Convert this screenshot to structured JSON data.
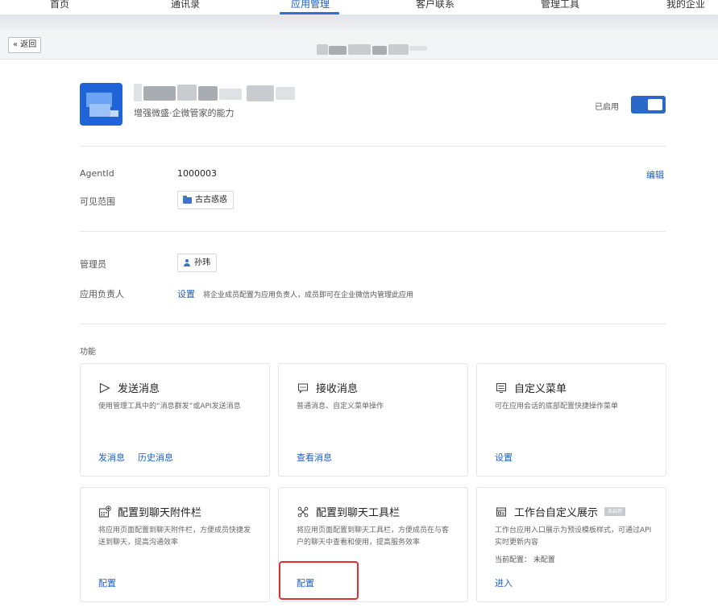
{
  "nav": {
    "items": [
      "首页",
      "通讯录",
      "应用管理",
      "客户联系",
      "管理工具",
      "我的企业"
    ],
    "active_index": 2
  },
  "subheader": {
    "back_label": "« 返回"
  },
  "app": {
    "subtitle": "增强微盛·企微管家的能力",
    "status_label": "已启用",
    "enabled": true
  },
  "info": {
    "agentid_label": "AgentId",
    "agentid_value": "1000003",
    "edit_label": "编辑",
    "visible_label": "可见范围",
    "visible_value": "古古惑惑",
    "admin_label": "管理员",
    "admin_value": "孙玮",
    "owner_label": "应用负责人",
    "owner_action": "设置",
    "owner_hint": "将企业成员配置为应用负责人，成员即可在企业微信内管理此应用"
  },
  "functions": {
    "section_label": "功能",
    "cards": [
      {
        "title": "发送消息",
        "icon": "send-icon",
        "desc": "使用管理工具中的“消息群发”或API发送消息",
        "actions": [
          "发消息",
          "历史消息"
        ]
      },
      {
        "title": "接收消息",
        "icon": "chat-bubble-icon",
        "desc": "普通消息、自定义菜单操作",
        "actions": [
          "查看消息"
        ]
      },
      {
        "title": "自定义菜单",
        "icon": "menu-icon",
        "desc": "可在应用会话的底部配置快捷操作菜单",
        "actions": [
          "设置"
        ]
      },
      {
        "title": "配置到聊天附件栏",
        "icon": "attachment-grid-icon",
        "desc": "将应用页面配置到聊天附件栏，方便成员快捷发送到聊天，提高沟通效率",
        "actions": [
          "配置"
        ]
      },
      {
        "title": "配置到聊天工具栏",
        "icon": "toolbar-icon",
        "desc": "将应用页面配置到聊天工具栏，方便成员在与客户的聊天中查看和使用，提高服务效率",
        "actions": [
          "配置"
        ]
      },
      {
        "title": "工作台自定义展示",
        "icon": "workbench-icon",
        "badge": "未启用",
        "desc": "工作台应用入口展示为预设模板样式，可通过API实时更新内容",
        "extra": "当前配置：  未配置",
        "actions": [
          "进入"
        ]
      }
    ]
  },
  "colors": {
    "accent": "#2a69c7",
    "link": "#1c5fc7",
    "highlight": "#e03131"
  }
}
